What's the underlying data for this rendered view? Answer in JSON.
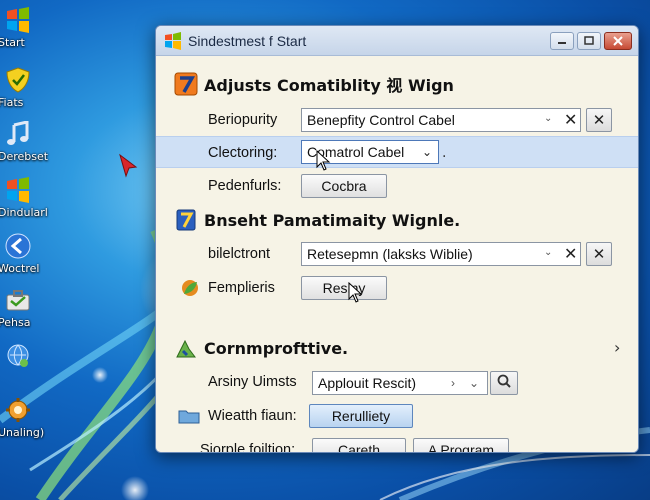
{
  "desktop": {
    "icons": [
      {
        "label": "Start",
        "icon": "windows-flag-icon"
      },
      {
        "label": "Fiats",
        "icon": "security-shield-icon"
      },
      {
        "label": "Derebset",
        "icon": "music-note-icon"
      },
      {
        "label": "Dindularl",
        "icon": "windows-flag-icon"
      },
      {
        "label": "Woctrel",
        "icon": "back-arrow-icon"
      },
      {
        "label": "Pehsa",
        "icon": "toolbox-icon"
      },
      {
        "label": "",
        "icon": "globe-person-icon"
      },
      {
        "label": "Unaling)",
        "icon": "gear-person-icon"
      }
    ]
  },
  "window": {
    "title": "Sindestmest f Start",
    "section1": {
      "title": "Adjusts Comatiblity 视 Wign",
      "rows": [
        {
          "label": "Beriopurity",
          "value": "Benepfity Control Cabel"
        },
        {
          "label": "Clectoring:",
          "value": "Comatrol Cabel"
        },
        {
          "label": "Pedenfurls:",
          "button": "Cocbra"
        }
      ]
    },
    "section2": {
      "title": "Bnseht Pamatimaity Wignle.",
      "rows": [
        {
          "label": "bilelctront",
          "value": "Retesepmn (laksks Wiblie)"
        },
        {
          "label": "Femplieris",
          "button": "Resiny"
        }
      ]
    },
    "section3": {
      "title": "Cornmprofttive.",
      "rows": [
        {
          "label": "Arsiny Uimsts",
          "value": "Applouit Rescit)"
        },
        {
          "label": "Wieatth fiaun:",
          "button": "Rerulliety"
        },
        {
          "label": "Siorple foiltion:",
          "button1": "Careth",
          "button2": "A Program"
        }
      ]
    },
    "colors": {
      "accent": "#2f7bd8",
      "highlight": "#cfe0f5",
      "panel": "#f6f3e6"
    }
  }
}
